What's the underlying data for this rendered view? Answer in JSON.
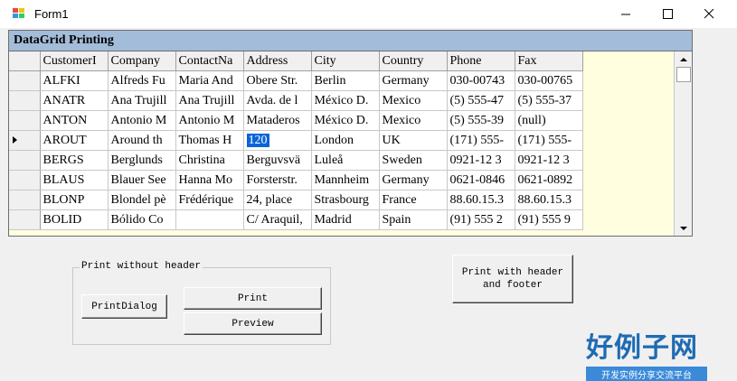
{
  "window": {
    "title": "Form1",
    "minimize_glyph": "—",
    "close_glyph": "✕"
  },
  "grid": {
    "caption": "DataGrid Printing",
    "columns": [
      "CustomerI",
      "Company",
      "ContactNa",
      "Address",
      "City",
      "Country",
      "Phone",
      "Fax"
    ],
    "rows": [
      [
        "ALFKI",
        "Alfreds Fu",
        "Maria And",
        "Obere Str.",
        "Berlin",
        "Germany",
        "030-00743",
        "030-00765"
      ],
      [
        "ANATR",
        "Ana Trujill",
        "Ana Trujill",
        "Avda. de l",
        "México D.",
        "Mexico",
        "(5) 555-47",
        "(5) 555-37"
      ],
      [
        "ANTON",
        "Antonio M",
        "Antonio M",
        "Mataderos",
        "México D.",
        "Mexico",
        "(5) 555-39",
        "(null)"
      ],
      [
        "AROUT",
        "Around th",
        "Thomas H",
        "120",
        "London",
        "UK",
        "(171) 555-",
        "(171) 555-"
      ],
      [
        "BERGS",
        "Berglunds",
        "Christina",
        "Berguvsvä",
        "Luleå",
        "Sweden",
        "0921-12 3",
        "0921-12 3"
      ],
      [
        "BLAUS",
        "Blauer See",
        "Hanna Mo",
        "Forsterstr.",
        "Mannheim",
        "Germany",
        "0621-0846",
        "0621-0892"
      ],
      [
        "BLONP",
        "Blondel pè",
        "Frédérique",
        "24, place",
        "Strasbourg",
        "France",
        "88.60.15.3",
        "88.60.15.3"
      ],
      [
        "BOLID",
        "Bólido Co",
        "",
        "C/ Araquil,",
        "Madrid",
        "Spain",
        "(91) 555 2",
        "(91) 555 9"
      ]
    ],
    "current_row": 3,
    "selected_cell": "120"
  },
  "group": {
    "legend": "Print without header",
    "print_dialog_label": "PrintDialog",
    "print_label": "Print",
    "preview_label": "Preview"
  },
  "print_header_footer_label": "Print with header and footer",
  "watermark": {
    "title": "好例子网",
    "subtitle": "开发实例分享交流平台"
  },
  "colors": {
    "caption_bg": "#a3bcd9",
    "grid_bg": "#ffffe0",
    "selection": "#0a64d8",
    "watermark": "#1f6bb3"
  }
}
